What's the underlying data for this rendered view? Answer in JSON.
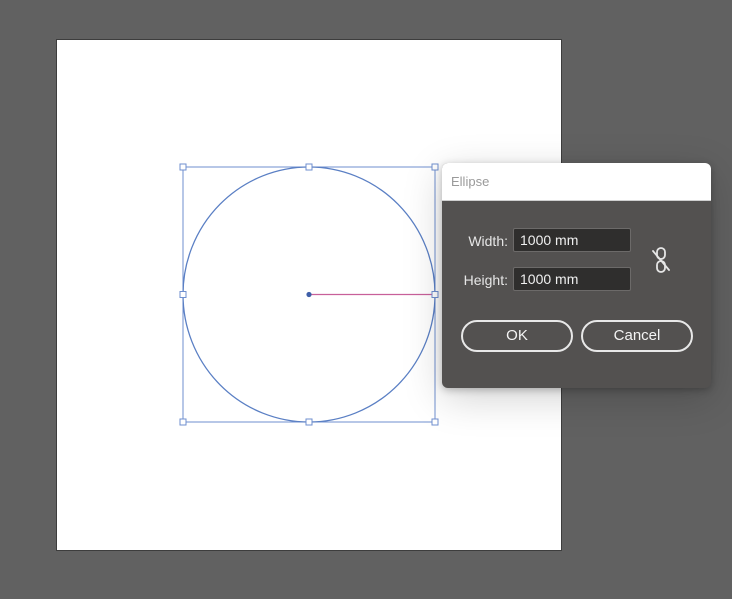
{
  "dialog": {
    "title": "Ellipse",
    "width_label": "Width:",
    "width_value": "1000 mm",
    "height_label": "Height:",
    "height_value": "1000 mm",
    "constrain_icon": "unlink-icon",
    "ok_label": "OK",
    "cancel_label": "Cancel"
  },
  "canvas": {
    "shape": "ellipse",
    "selection_color": "#5a7fc4",
    "radius_guide_color": "#c8609a"
  }
}
